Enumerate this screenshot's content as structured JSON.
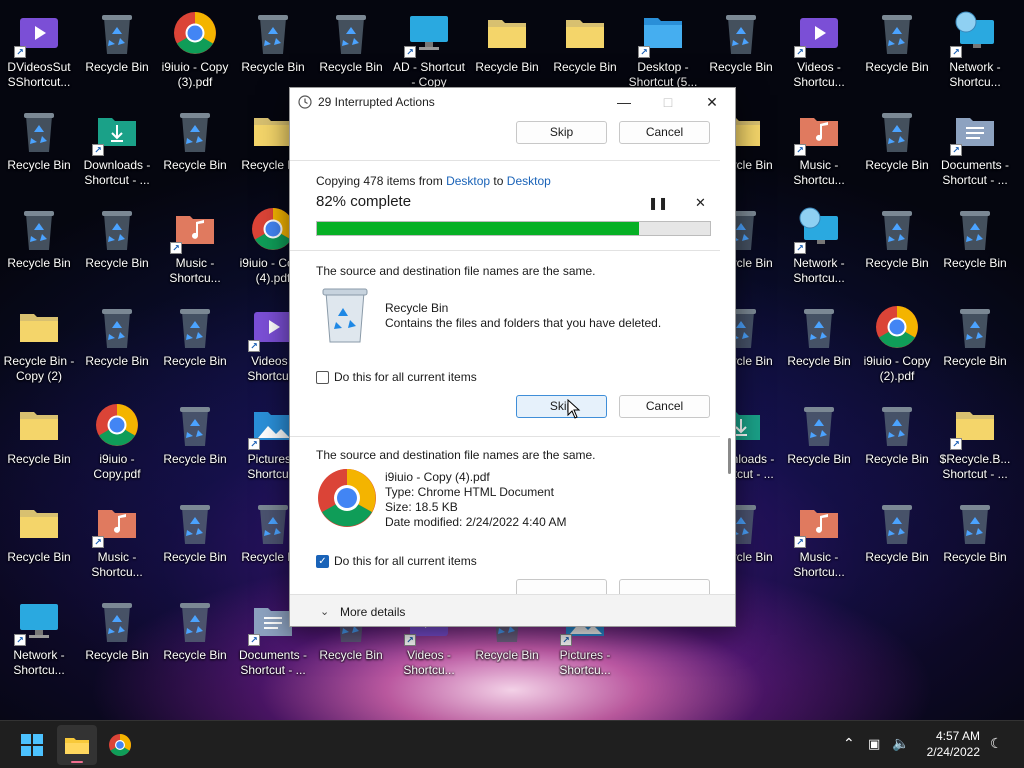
{
  "desktop": {
    "icons": [
      {
        "label": "DVideosSut\nSShortcut...",
        "type": "video",
        "shortcut": true
      },
      {
        "label": "Recycle Bin",
        "type": "recycle",
        "shortcut": false
      },
      {
        "label": "i9iuio - Copy (3).pdf",
        "type": "chrome",
        "shortcut": false
      },
      {
        "label": "Recycle Bin",
        "type": "recycle",
        "shortcut": false
      },
      {
        "label": "Recycle Bin",
        "type": "recycle",
        "shortcut": false
      },
      {
        "label": "AD - Shortcut - Copy",
        "type": "monitor",
        "shortcut": true
      },
      {
        "label": "Recycle Bin",
        "type": "folder",
        "shortcut": false
      },
      {
        "label": "Recycle Bin",
        "type": "folder",
        "shortcut": false
      },
      {
        "label": "Desktop - Shortcut (5...",
        "type": "desktop",
        "shortcut": true
      },
      {
        "label": "Recycle Bin",
        "type": "recycle",
        "shortcut": false
      },
      {
        "label": "Videos - Shortcu...",
        "type": "video",
        "shortcut": true
      },
      {
        "label": "Recycle Bin",
        "type": "recycle",
        "shortcut": false
      },
      {
        "label": "Network - Shortcu...",
        "type": "network",
        "shortcut": true
      },
      {
        "label": "Recycle Bin",
        "type": "recycle",
        "shortcut": false
      },
      {
        "label": "Downloads - Shortcut - ...",
        "type": "downloads",
        "shortcut": true
      },
      {
        "label": "Recycle Bin",
        "type": "recycle",
        "shortcut": false
      },
      {
        "label": "Recycle Bin",
        "type": "folder",
        "shortcut": false
      },
      {
        "label": "Recycle Bin",
        "type": "folder",
        "shortcut": false
      },
      {
        "label": "Music - Shortcu...",
        "type": "music",
        "shortcut": true
      },
      {
        "label": "Recycle Bin",
        "type": "recycle",
        "shortcut": false
      },
      {
        "label": "Documents - Shortcut - ...",
        "type": "documents",
        "shortcut": true
      },
      {
        "label": "Recycle Bin",
        "type": "recycle",
        "shortcut": false
      },
      {
        "label": "Recycle Bin",
        "type": "recycle",
        "shortcut": false
      },
      {
        "label": "Music - Shortcu...",
        "type": "music",
        "shortcut": true
      },
      {
        "label": "i9iuio - Copy (4).pdf",
        "type": "chrome",
        "shortcut": false
      },
      {
        "label": "Recycle Bin",
        "type": "recycle",
        "shortcut": false
      },
      {
        "label": "Network - Shortcu...",
        "type": "network",
        "shortcut": true
      },
      {
        "label": "Recycle Bin",
        "type": "recycle",
        "shortcut": false
      },
      {
        "label": "Recycle Bin",
        "type": "recycle",
        "shortcut": false
      },
      {
        "label": "Recycle Bin - Copy (2)",
        "type": "folder",
        "shortcut": false
      },
      {
        "label": "Recycle Bin",
        "type": "recycle",
        "shortcut": false
      },
      {
        "label": "Recycle Bin",
        "type": "recycle",
        "shortcut": false
      },
      {
        "label": "Videos - Shortcu...",
        "type": "video",
        "shortcut": true
      },
      {
        "label": "Recycle Bin",
        "type": "recycle",
        "shortcut": false
      },
      {
        "label": "Recycle Bin",
        "type": "recycle",
        "shortcut": false
      },
      {
        "label": "i9iuio - Copy (2).pdf",
        "type": "chrome",
        "shortcut": false
      },
      {
        "label": "Recycle Bin",
        "type": "recycle",
        "shortcut": false
      },
      {
        "label": "Recycle Bin",
        "type": "folder",
        "shortcut": false
      },
      {
        "label": "i9iuio - Copy.pdf",
        "type": "chrome",
        "shortcut": false
      },
      {
        "label": "Recycle Bin",
        "type": "recycle",
        "shortcut": false
      },
      {
        "label": "Pictures - Shortcu...",
        "type": "pictures",
        "shortcut": true
      },
      {
        "label": "Downloads - Shortcut - ...",
        "type": "downloads",
        "shortcut": true
      },
      {
        "label": "Recycle Bin",
        "type": "recycle",
        "shortcut": false
      },
      {
        "label": "Recycle Bin",
        "type": "recycle",
        "shortcut": false
      },
      {
        "label": "$Recycle.B... Shortcut - ...",
        "type": "folder",
        "shortcut": true
      },
      {
        "label": "Recycle Bin",
        "type": "folder",
        "shortcut": false
      },
      {
        "label": "Music - Shortcu...",
        "type": "music",
        "shortcut": true
      },
      {
        "label": "Recycle Bin",
        "type": "recycle",
        "shortcut": false
      },
      {
        "label": "Recycle Bin",
        "type": "recycle",
        "shortcut": false
      },
      {
        "label": "Recycle Bin",
        "type": "recycle",
        "shortcut": false
      },
      {
        "label": "Music - Shortcu...",
        "type": "music",
        "shortcut": true
      },
      {
        "label": "Recycle Bin",
        "type": "recycle",
        "shortcut": false
      },
      {
        "label": "Recycle Bin",
        "type": "recycle",
        "shortcut": false
      },
      {
        "label": "Network - Shortcu...",
        "type": "monitor",
        "shortcut": true
      },
      {
        "label": "Recycle Bin",
        "type": "recycle",
        "shortcut": false
      },
      {
        "label": "Recycle Bin",
        "type": "recycle",
        "shortcut": false
      },
      {
        "label": "Documents - Shortcut - ...",
        "type": "documents",
        "shortcut": true
      },
      {
        "label": "Recycle Bin",
        "type": "recycle",
        "shortcut": false
      },
      {
        "label": "Videos - Shortcu...",
        "type": "video",
        "shortcut": true
      },
      {
        "label": "Recycle Bin",
        "type": "recycle",
        "shortcut": false
      },
      {
        "label": "Pictures - Shortcu...",
        "type": "pictures",
        "shortcut": true
      }
    ]
  },
  "dialog": {
    "title": "29 Interrupted Actions",
    "top_skip_label": "Skip",
    "top_cancel_label": "Cancel",
    "copy_prefix": "Copying 478 items from ",
    "copy_source": "Desktop",
    "copy_middle": " to ",
    "copy_dest": "Desktop",
    "progress_text": "82% complete",
    "progress_fraction": 0.82,
    "conflict1": {
      "heading": "The source and destination file names are the same.",
      "item_name": "Recycle Bin",
      "item_desc": "Contains the files and folders that you have deleted.",
      "checkbox_label": "Do this for all current items",
      "checked": false,
      "skip_label": "Skip",
      "cancel_label": "Cancel"
    },
    "conflict2": {
      "heading": "The source and destination file names are the same.",
      "item_name": "i9iuio - Copy (4).pdf",
      "item_type": "Type: Chrome HTML Document",
      "item_size": "Size: 18.5 KB",
      "item_date": "Date modified: 2/24/2022 4:40 AM",
      "checkbox_label": "Do this for all current items",
      "checked": true
    },
    "more_details_label": "More details"
  },
  "taskbar": {
    "time": "4:57 AM",
    "date": "2/24/2022",
    "icons": [
      "windows-start-icon",
      "file-explorer-icon",
      "chrome-icon"
    ]
  },
  "colors": {
    "accent": "#1a63b8",
    "progress": "#06b025"
  }
}
